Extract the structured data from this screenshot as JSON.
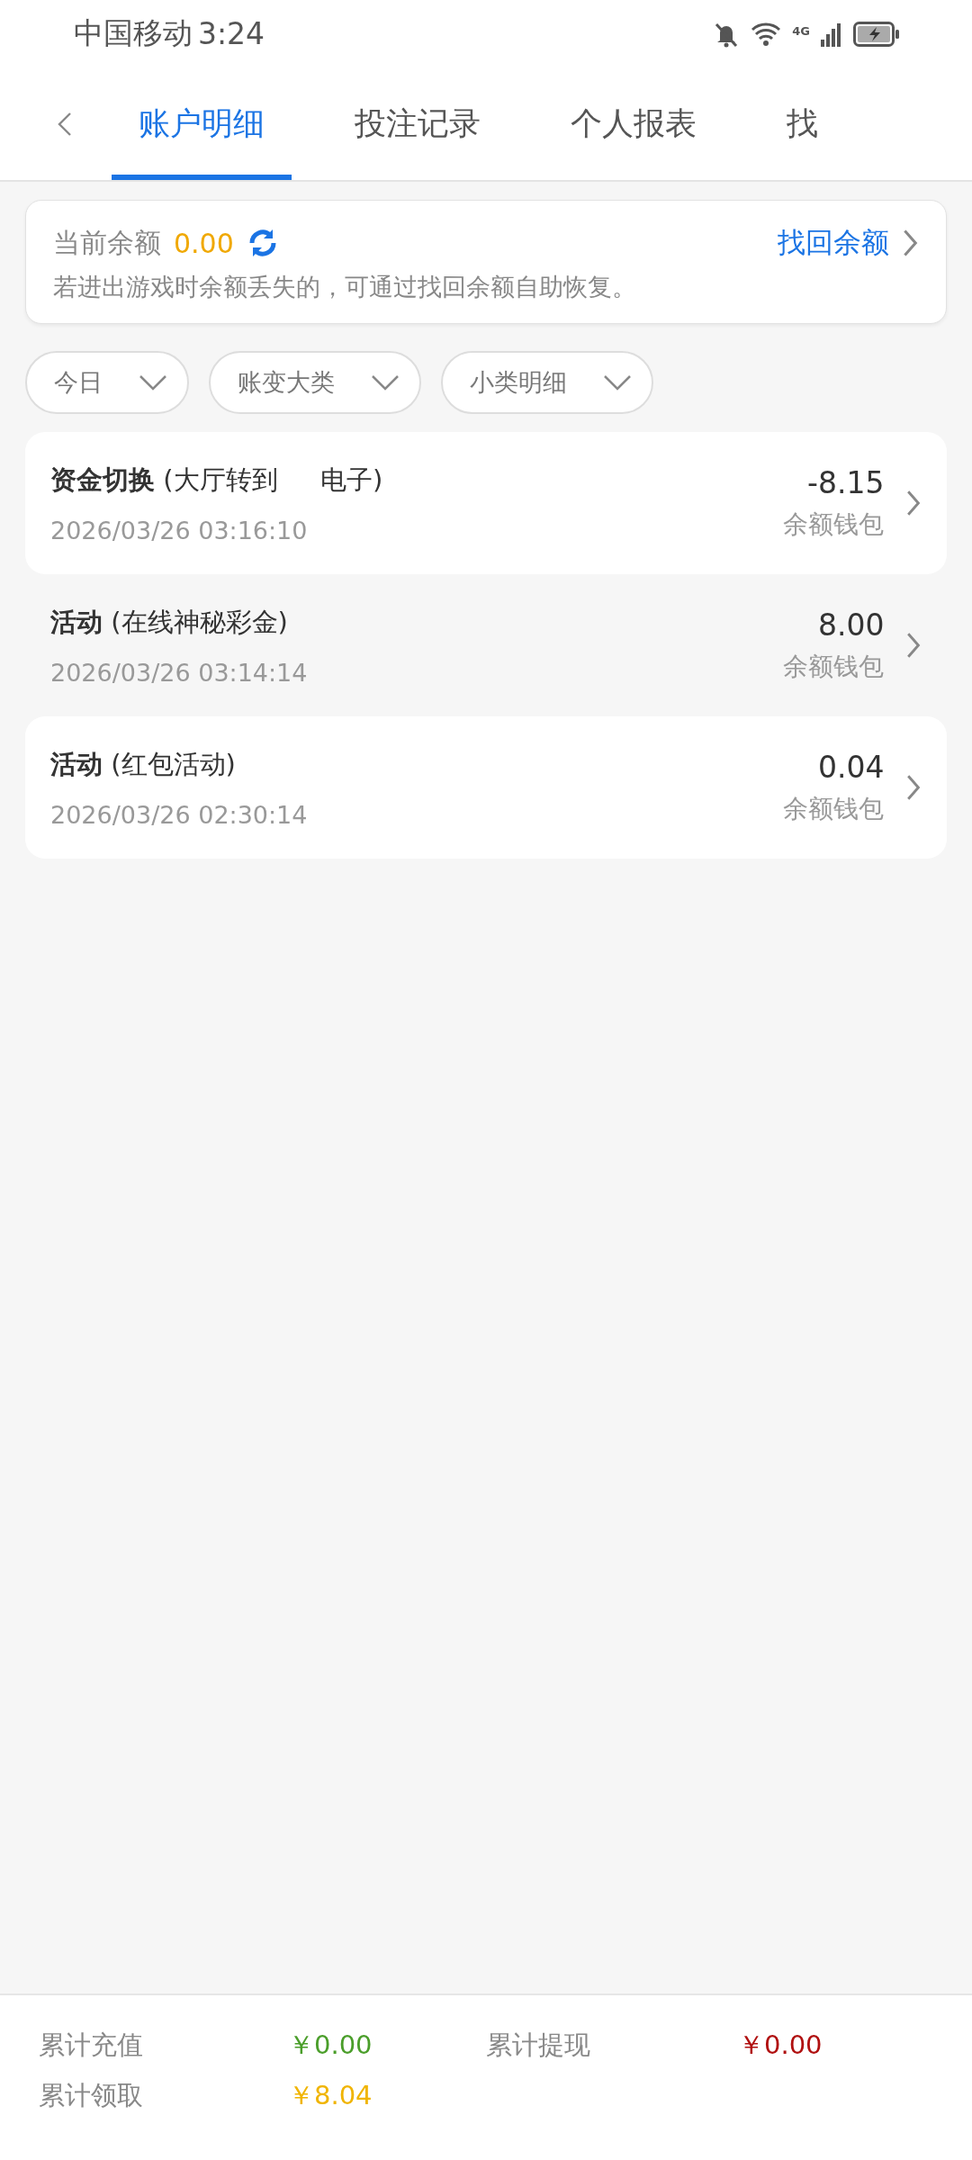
{
  "status_bar": {
    "carrier": "中国移动",
    "time": "3:24",
    "network": "4G"
  },
  "tabs": [
    {
      "label": "账户明细",
      "selected": true
    },
    {
      "label": "投注记录",
      "selected": false
    },
    {
      "label": "个人报表",
      "selected": false
    },
    {
      "label": "找",
      "selected": false
    }
  ],
  "balance_card": {
    "label": "当前余额",
    "amount": "0.00",
    "link": "找回余额",
    "hint": "若进出游戏时余额丢失的，可通过找回余额自助恢复。"
  },
  "filters": [
    {
      "label": "今日"
    },
    {
      "label": "账变大类"
    },
    {
      "label": "小类明细"
    }
  ],
  "records": [
    {
      "kind": "card",
      "type": "资金切换",
      "detail": "(大厅转到 　 电子)",
      "time": "2026/03/26 03:16:10",
      "amount": "-8.15",
      "wallet": "余额钱包"
    },
    {
      "kind": "plain",
      "type": "活动",
      "detail": "(在线神秘彩金)",
      "time": "2026/03/26 03:14:14",
      "amount": "8.00",
      "wallet": "余额钱包"
    },
    {
      "kind": "card",
      "type": "活动",
      "detail": "(红包活动)",
      "time": "2026/03/26 02:30:14",
      "amount": "0.04",
      "wallet": "余额钱包"
    }
  ],
  "totals": [
    {
      "label": "累计充值",
      "value": "￥0.00",
      "color": "#4a9e2a"
    },
    {
      "label": "累计提现",
      "value": "￥0.00",
      "color": "#b01010"
    },
    {
      "label": "累计领取",
      "value": "￥8.04",
      "color": "#f0b400"
    }
  ]
}
